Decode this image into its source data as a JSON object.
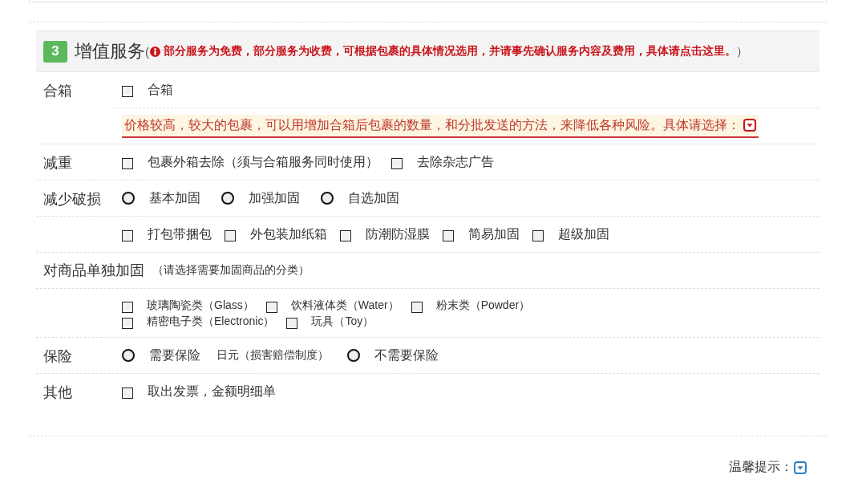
{
  "section": {
    "number": "3",
    "title": "增值服务",
    "notice_open": "(",
    "notice": "部分服务为免费，部分服务为收费，可根据包裹的具体情况选用，并请事先确认服务内容及费用，具体请点击这里。",
    "notice_close": "）"
  },
  "rows": [
    {
      "kind": "field",
      "label": "合箱",
      "lines": [
        {
          "kind": "checkboxes",
          "options": [
            {
              "label": "合箱",
              "checked": false
            }
          ]
        },
        {
          "kind": "note",
          "text": "价格较高，较大的包裹，可以用增加合箱后包裹的数量，和分批发送的方法，来降低各种风险。具体请选择："
        }
      ]
    },
    {
      "kind": "field",
      "label": "减重",
      "lines": [
        {
          "kind": "checkboxes",
          "options": [
            {
              "label": "包裹外箱去除（须与合箱服务同时使用）",
              "checked": false
            },
            {
              "label": "去除杂志广告",
              "checked": false
            }
          ]
        }
      ]
    },
    {
      "kind": "field",
      "label": "减少破损",
      "lines": [
        {
          "kind": "radios",
          "options": [
            {
              "label": "基本加固",
              "selected": false
            },
            {
              "label": "加强加固",
              "selected": false
            },
            {
              "label": "自选加固",
              "selected": false
            }
          ]
        }
      ]
    },
    {
      "kind": "field",
      "lines": [
        {
          "kind": "checkboxes",
          "options": [
            {
              "label": "打包带捆包",
              "checked": false
            },
            {
              "label": "外包装加纸箱",
              "checked": false
            },
            {
              "label": "防潮防湿膜",
              "checked": false
            },
            {
              "label": "简易加固",
              "checked": false
            },
            {
              "label": "超级加固",
              "checked": false
            }
          ]
        }
      ]
    },
    {
      "kind": "heading",
      "label": "对商品单独加固",
      "hint": "（请选择需要加固商品的分类）"
    },
    {
      "kind": "field",
      "lines": [
        {
          "kind": "compact_checkboxes",
          "options": [
            {
              "label": "玻璃陶瓷类（Glass）",
              "checked": false
            },
            {
              "label": "饮料液体类（Water）",
              "checked": false
            },
            {
              "label": "粉末类（Powder）",
              "checked": false
            },
            {
              "label": "精密电子类（Electronic）",
              "checked": false
            },
            {
              "label": "玩具（Toy）",
              "checked": false
            }
          ]
        }
      ]
    },
    {
      "kind": "field",
      "label": "保险",
      "lines": [
        {
          "kind": "radios",
          "options": [
            {
              "label": "需要保险",
              "selected": false,
              "note": "日元（损害赔偿制度）"
            },
            {
              "label": "不需要保险",
              "selected": false
            }
          ]
        }
      ]
    },
    {
      "kind": "field",
      "label": "其他",
      "lines": [
        {
          "kind": "checkboxes",
          "options": [
            {
              "label": "取出发票，金额明细单",
              "checked": false
            }
          ]
        }
      ]
    }
  ],
  "footer": {
    "tip": "温馨提示："
  }
}
